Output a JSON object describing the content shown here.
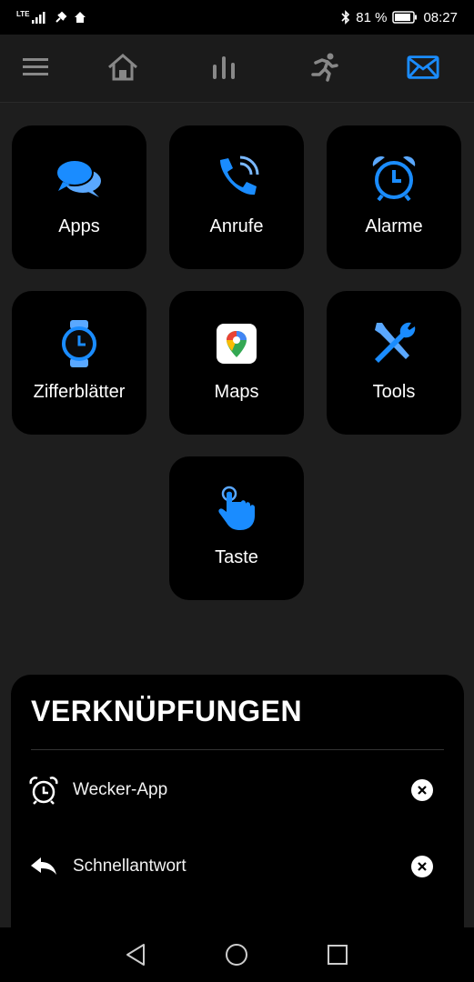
{
  "status": {
    "network": "LTE",
    "battery": "81 %",
    "time": "08:27"
  },
  "colors": {
    "accent": "#1a8cff",
    "tile_bg": "#000000",
    "page_bg": "#1e1e1e"
  },
  "topnav": {
    "items": [
      {
        "name": "menu-icon"
      },
      {
        "name": "home-icon"
      },
      {
        "name": "chart-icon"
      },
      {
        "name": "running-icon"
      },
      {
        "name": "envelope-icon",
        "active": true
      }
    ]
  },
  "tiles": [
    {
      "label": "Apps",
      "icon": "chat-bubbles-icon"
    },
    {
      "label": "Anrufe",
      "icon": "phone-ringing-icon"
    },
    {
      "label": "Alarme",
      "icon": "alarm-clock-icon"
    },
    {
      "label": "Zifferblätter",
      "icon": "watch-icon"
    },
    {
      "label": "Maps",
      "icon": "maps-icon"
    },
    {
      "label": "Tools",
      "icon": "tools-icon"
    },
    {
      "label": "Taste",
      "icon": "tap-hand-icon"
    }
  ],
  "shortcuts": {
    "title": "VERKNÜPFUNGEN",
    "items": [
      {
        "label": "Wecker-App",
        "icon": "alarm-clock-icon"
      },
      {
        "label": "Schnellantwort",
        "icon": "reply-icon"
      }
    ]
  }
}
